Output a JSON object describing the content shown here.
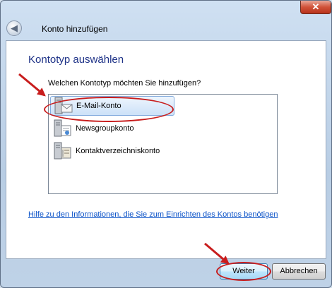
{
  "window": {
    "title": "Konto hinzufügen",
    "close_glyph": "✕",
    "back_glyph": "◀"
  },
  "page": {
    "heading": "Kontotyp auswählen",
    "question": "Welchen Kontotyp möchten Sie hinzufügen?"
  },
  "account_types": [
    {
      "label": "E-Mail-Konto",
      "icon": "email-server-icon",
      "selected": true
    },
    {
      "label": "Newsgroupkonto",
      "icon": "newsgroup-server-icon",
      "selected": false
    },
    {
      "label": "Kontaktverzeichniskonto",
      "icon": "directory-server-icon",
      "selected": false
    }
  ],
  "help_link": "Hilfe zu den Informationen, die Sie zum Einrichten des Kontos benötigen",
  "buttons": {
    "next": "Weiter",
    "cancel": "Abbrechen"
  },
  "colors": {
    "heading": "#1e3287",
    "link": "#0a52c8",
    "annotation": "#c81d1d"
  }
}
